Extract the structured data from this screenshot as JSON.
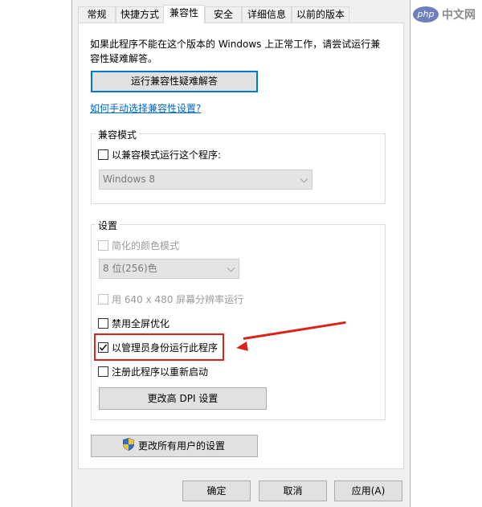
{
  "tabs": [
    {
      "label": "常规",
      "active": false
    },
    {
      "label": "快捷方式",
      "active": false
    },
    {
      "label": "兼容性",
      "active": true
    },
    {
      "label": "安全",
      "active": false
    },
    {
      "label": "详细信息",
      "active": false
    },
    {
      "label": "以前的版本",
      "active": false
    }
  ],
  "intro_text": "如果此程序不能在这个版本的 Windows 上正常工作，请尝试运行兼容性疑难解答。",
  "troubleshooter_button": "运行兼容性疑难解答",
  "manual_link": "如何手动选择兼容性设置?",
  "compat_mode": {
    "title": "兼容模式",
    "checkbox_label": "以兼容模式运行这个程序:",
    "checked": false,
    "os_select": "Windows 8"
  },
  "settings": {
    "title": "设置",
    "reduced_color": {
      "label": "简化的颜色模式",
      "checked": false,
      "enabled": false
    },
    "color_select": "8 位(256)色",
    "low_res": {
      "label": "用 640 x 480 屏幕分辨率运行",
      "checked": false,
      "enabled": false
    },
    "disable_fullscreen": {
      "label": "禁用全屏优化",
      "checked": false
    },
    "run_as_admin": {
      "label": "以管理员身份运行此程序",
      "checked": true
    },
    "register_restart": {
      "label": "注册此程序以重新启动",
      "checked": false
    },
    "dpi_button": "更改高 DPI 设置"
  },
  "all_users_button": "更改所有用户的设置",
  "footer": {
    "ok": "确定",
    "cancel": "取消",
    "apply": "应用(A)"
  },
  "watermark": {
    "logo": "php",
    "text": "中文网"
  },
  "colors": {
    "accent": "#0078d7",
    "highlight": "#d9241c",
    "link": "#0066cc"
  }
}
